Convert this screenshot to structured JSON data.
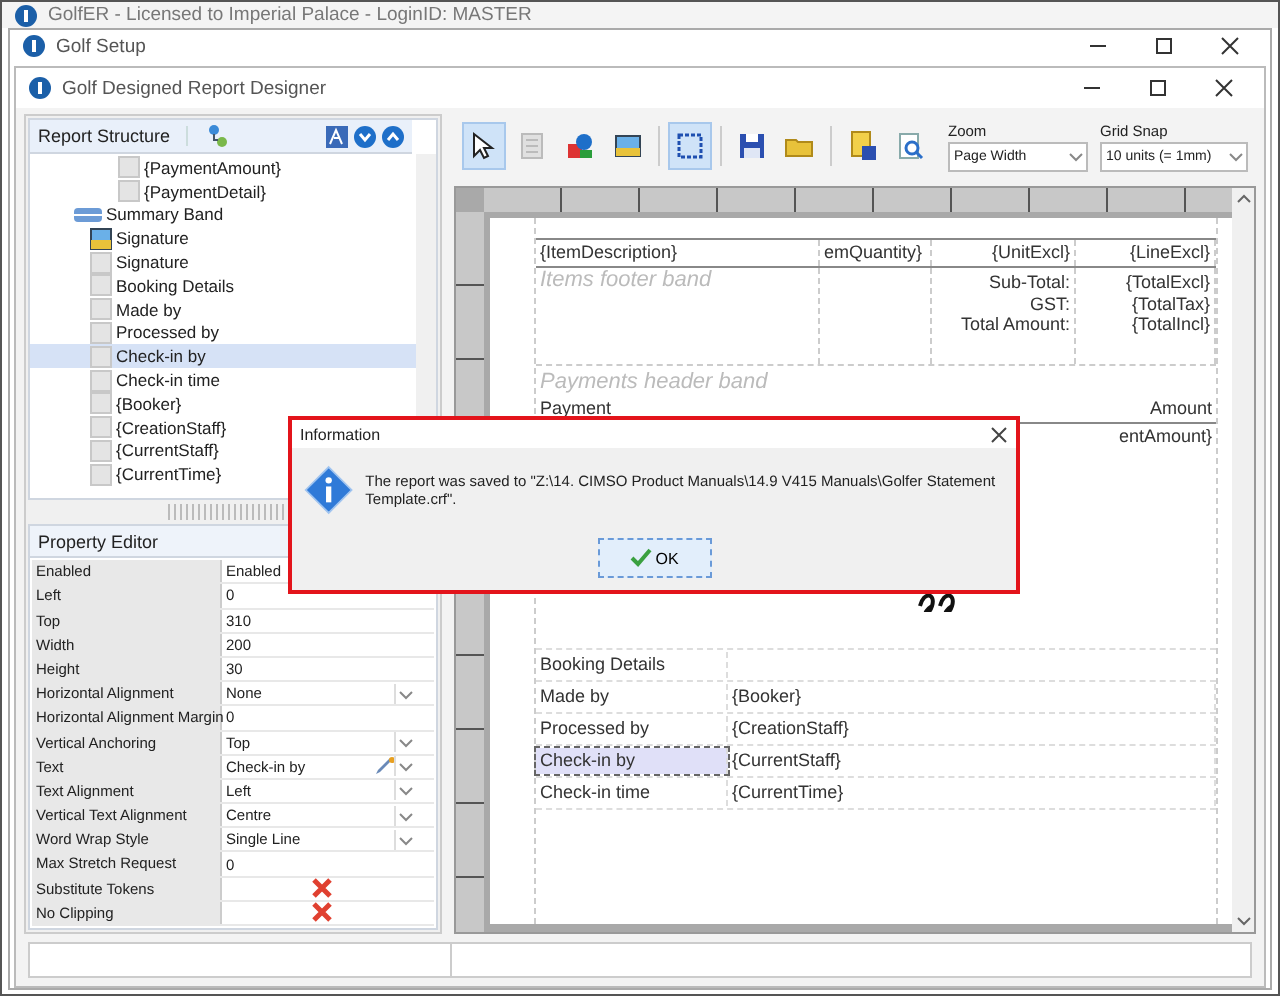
{
  "windows": [
    {
      "title": "GolfER - Licensed to Imperial Palace - LoginID: MASTER"
    },
    {
      "title": "Golf Setup"
    }
  ],
  "designer": {
    "title": "Golf Designed Report Designer"
  },
  "report_structure": {
    "title": "Report Structure",
    "scrolled_children": [
      {
        "label": "{PaymentAmount}",
        "kind": "text",
        "selected": false
      },
      {
        "label": "{PaymentDetail}",
        "kind": "text",
        "selected": false
      }
    ],
    "items": [
      {
        "label": "Summary Band",
        "kind": "band",
        "selected": false,
        "children": [
          {
            "label": "Signature",
            "kind": "image",
            "selected": false
          },
          {
            "label": "Signature",
            "kind": "text",
            "selected": false
          },
          {
            "label": "Booking Details",
            "kind": "text",
            "selected": false
          },
          {
            "label": "Made by",
            "kind": "text",
            "selected": false
          },
          {
            "label": "Processed by",
            "kind": "text",
            "selected": false
          },
          {
            "label": "Check-in by",
            "kind": "text",
            "selected": true
          },
          {
            "label": "Check-in time",
            "kind": "text",
            "selected": false
          },
          {
            "label": "{Booker}",
            "kind": "text",
            "selected": false
          },
          {
            "label": "{CreationStaff}",
            "kind": "text",
            "selected": false
          },
          {
            "label": "{CurrentStaff}",
            "kind": "text",
            "selected": false
          },
          {
            "label": "{CurrentTime}",
            "kind": "text",
            "selected": false
          }
        ]
      }
    ]
  },
  "property_editor": {
    "title": "Property Editor",
    "rows": [
      {
        "name": "Enabled",
        "value": "Enabled",
        "kind": "text"
      },
      {
        "name": "Left",
        "value": "0",
        "kind": "text"
      },
      {
        "name": "Top",
        "value": "310",
        "kind": "text"
      },
      {
        "name": "Width",
        "value": "200",
        "kind": "text"
      },
      {
        "name": "Height",
        "value": "30",
        "kind": "text"
      },
      {
        "name": "Horizontal Alignment",
        "value": "None",
        "kind": "dropdown"
      },
      {
        "name": "Horizontal Alignment Margin",
        "value": "0",
        "kind": "text"
      },
      {
        "name": "Vertical Anchoring",
        "value": "Top",
        "kind": "dropdown"
      },
      {
        "name": "Text",
        "value": "Check-in by",
        "kind": "edit-dropdown"
      },
      {
        "name": "Text Alignment",
        "value": "Left",
        "kind": "dropdown"
      },
      {
        "name": "Vertical Text Alignment",
        "value": "Centre",
        "kind": "dropdown"
      },
      {
        "name": "Word Wrap Style",
        "value": "Single Line",
        "kind": "dropdown"
      },
      {
        "name": "Max Stretch Request",
        "value": "0",
        "kind": "text"
      },
      {
        "name": "Substitute Tokens",
        "kind": "cross"
      },
      {
        "name": "No Clipping",
        "kind": "cross"
      }
    ]
  },
  "toolbar": {
    "tools": [
      {
        "kind": "pointer",
        "selected": true
      },
      {
        "kind": "page",
        "selected": false
      },
      {
        "kind": "shapes",
        "selected": false
      },
      {
        "kind": "picture",
        "selected": false
      },
      {
        "kind": "sep"
      },
      {
        "kind": "select",
        "selected": true
      },
      {
        "kind": "sep"
      },
      {
        "kind": "save",
        "selected": false
      },
      {
        "kind": "open",
        "selected": false
      },
      {
        "kind": "sep"
      },
      {
        "kind": "save-as",
        "selected": false
      },
      {
        "kind": "preview",
        "selected": false
      }
    ],
    "zoom": {
      "label": "Zoom",
      "value": "Page Width"
    },
    "grid_snap": {
      "label": "Grid Snap",
      "value": "10 units (= 1mm)"
    }
  },
  "report": {
    "item_cells": [
      "{ItemDescription}",
      "emQuantity}",
      "{UnitExcl}",
      "{LineExcl}"
    ],
    "footer_band": "Items footer band",
    "total_labels": [
      "Sub-Total:",
      "GST:",
      "Total Amount:"
    ],
    "total_values": [
      "{TotalExcl}",
      "{TotalTax}",
      "{TotalIncl}"
    ],
    "payments_band": "Payments header band",
    "payment_headers": [
      "Payment",
      "Amount"
    ],
    "payment_cells": [
      "entAmount}"
    ],
    "summary_rows": [
      {
        "label": "Booking Details",
        "selected": false
      },
      {
        "label": "Made by",
        "value": "{Booker}",
        "selected": false
      },
      {
        "label": "Processed by",
        "value": "{CreationStaff}",
        "selected": false
      },
      {
        "label": "Check-in by",
        "value": "{CurrentStaff}",
        "selected": true
      },
      {
        "label": "Check-in time",
        "value": "{CurrentTime}",
        "selected": false
      }
    ]
  },
  "dialog": {
    "title": "Information",
    "message": "The report was saved to \"Z:\\14. CIMSO Product Manuals\\14.9 V415 Manuals\\Golfer Statement Template.crf\".",
    "button": "OK"
  }
}
